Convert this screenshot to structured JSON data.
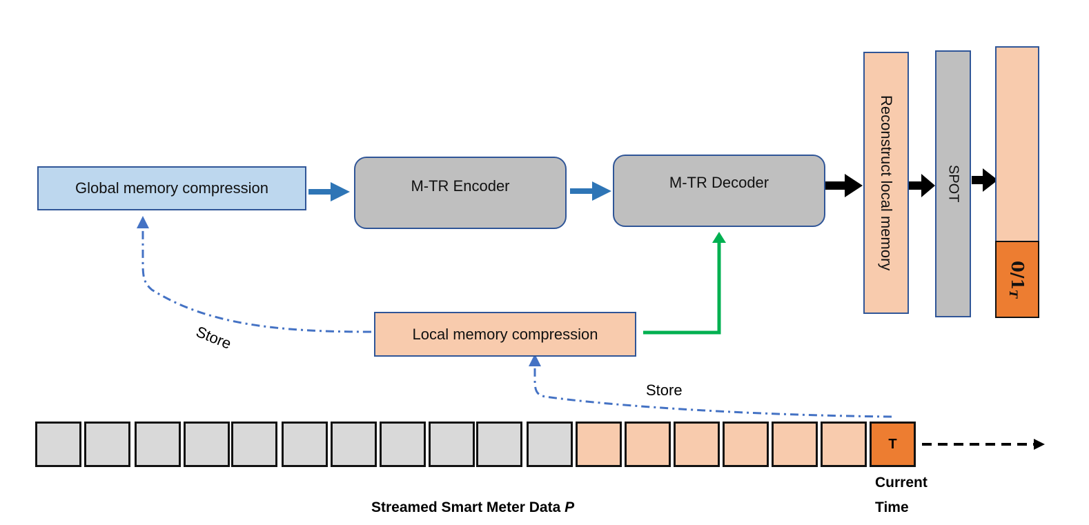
{
  "diagram": {
    "blocks": {
      "global_memory": "Global memory compression",
      "encoder": "M-TR Encoder",
      "decoder": "M-TR Decoder",
      "local_memory": "Local memory compression",
      "reconstruct": "Reconstruct local memory",
      "spot": "SPOT",
      "output_label": "0/1",
      "output_subscript": "T"
    },
    "labels": {
      "store_global": "Store",
      "store_local": "Store",
      "stream_title": "Streamed Smart Meter Data ",
      "stream_var": "P",
      "current_time_line1": "Current",
      "current_time_line2": "Time",
      "current_cell": "T"
    },
    "stream": {
      "past_cells": 11,
      "local_cells": 6,
      "current_cells": 1
    },
    "colors": {
      "blue_fill": "#bdd7ee",
      "grey_fill": "#bfbfbf",
      "peach_fill": "#f8cbad",
      "orange": "#ed7d31",
      "border_blue": "#2f5597",
      "arrow_blue": "#2e75b6",
      "dash_blue": "#4472c4",
      "green": "#00b050"
    }
  }
}
